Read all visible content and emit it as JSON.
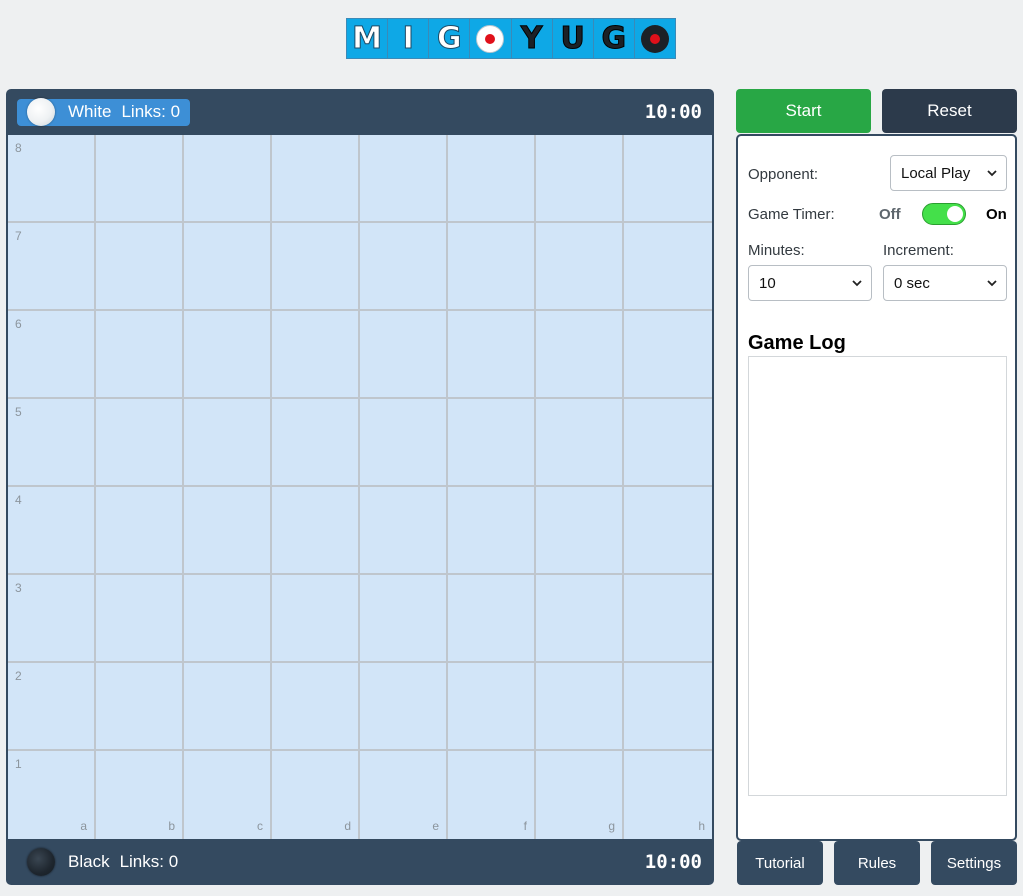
{
  "logo": {
    "letters": [
      "M",
      "I",
      "G",
      "",
      "Y",
      "U",
      "G",
      ""
    ]
  },
  "players": {
    "white": {
      "name": "White",
      "links": "Links: 0",
      "clock": "10:00",
      "active": true
    },
    "black": {
      "name": "Black",
      "links": "Links: 0",
      "clock": "10:00",
      "active": false
    }
  },
  "board": {
    "ranks": [
      "8",
      "7",
      "6",
      "5",
      "4",
      "3",
      "2",
      "1"
    ],
    "files": [
      "a",
      "b",
      "c",
      "d",
      "e",
      "f",
      "g",
      "h"
    ]
  },
  "controls": {
    "start_label": "Start",
    "reset_label": "Reset",
    "opponent_label": "Opponent:",
    "opponent_value": "Local Play",
    "timer_label": "Game Timer:",
    "timer_off": "Off",
    "timer_on": "On",
    "timer_enabled": true,
    "minutes_label": "Minutes:",
    "minutes_value": "10",
    "increment_label": "Increment:",
    "increment_value": "0 sec",
    "log_title": "Game Log",
    "log_entries": []
  },
  "footer": {
    "tutorial_label": "Tutorial",
    "rules_label": "Rules",
    "settings_label": "Settings"
  },
  "colors": {
    "start": "#28a745",
    "reset": "#2c3a4b",
    "panel": "#344a60",
    "active_player": "#3d8fd6",
    "board_cell": "#d2e5f8",
    "toggle_on": "#44e04a"
  }
}
